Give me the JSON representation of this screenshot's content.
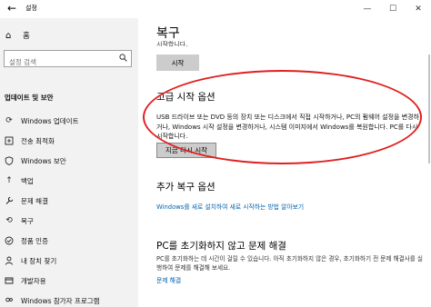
{
  "window": {
    "title": "설정",
    "back_icon": "back-arrow-icon",
    "controls": {
      "minimize": "—",
      "maximize": "☐",
      "close": "✕"
    }
  },
  "sidebar": {
    "home_label": "홈",
    "search_placeholder": "설정 검색",
    "section_header": "업데이트 및 보안",
    "items": [
      {
        "label": "Windows 업데이트",
        "icon": "refresh-icon"
      },
      {
        "label": "전송 최적화",
        "icon": "delivery-optimization-icon"
      },
      {
        "label": "Windows 보안",
        "icon": "shield-icon"
      },
      {
        "label": "백업",
        "icon": "upload-arrow-icon"
      },
      {
        "label": "문제 해결",
        "icon": "wrench-icon"
      },
      {
        "label": "복구",
        "icon": "recovery-icon"
      },
      {
        "label": "정품 인증",
        "icon": "check-circle-icon"
      },
      {
        "label": "내 장치 찾기",
        "icon": "person-location-icon"
      },
      {
        "label": "개발자용",
        "icon": "developer-icon"
      },
      {
        "label": "Windows 참가자 프로그램",
        "icon": "insider-icon"
      }
    ]
  },
  "main": {
    "title": "복구",
    "partial_text": "시작합니다.",
    "start_button": "시작",
    "advanced": {
      "heading": "고급 시작 옵션",
      "description": "USB 드라이브 또는 DVD 등의 장치 또는 디스크에서 직접 시작하거나, PC의 펌웨어 설정을 변경하거나, Windows 시작 설정을 변경하거나, 시스템 이미지에서 Windows를 복원합니다. PC를 다시 시작합니다.",
      "button": "지금 다시 시작"
    },
    "more": {
      "heading": "추가 복구 옵션",
      "link": "Windows를 새로 설치하여 새로 시작하는 방법 알아보기"
    },
    "fix": {
      "heading": "PC를 초기화하지 않고 문제 해결",
      "description": "PC를 초기화하는 데 시간이 걸릴 수 있습니다. 아직 초기화하지 않은 경우, 초기화하기 전 문제 해결사를 실행하여 문제를 해결해 보세요.",
      "link": "문제 해결"
    }
  }
}
